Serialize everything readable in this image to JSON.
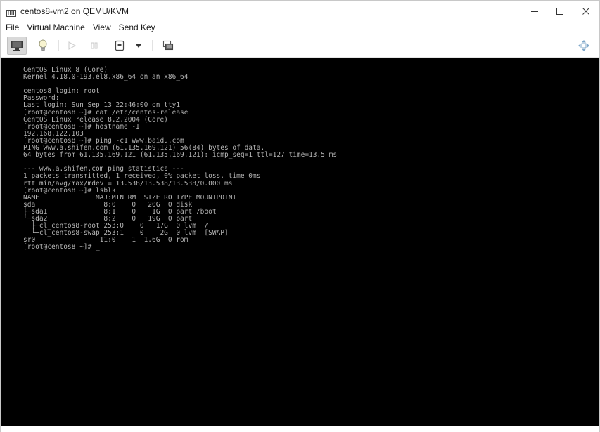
{
  "window": {
    "title": "centos8-vm2 on QEMU/KVM",
    "controls": {
      "minimize": "—",
      "maximize": "☐",
      "close": "✕"
    }
  },
  "menubar": {
    "items": [
      "File",
      "Virtual Machine",
      "View",
      "Send Key"
    ]
  },
  "toolbar": {
    "buttons": [
      {
        "name": "console-view-icon",
        "state": "pressed"
      },
      {
        "name": "lightbulb-details-icon",
        "state": "enabled"
      },
      {
        "name": "run-icon",
        "state": "disabled"
      },
      {
        "name": "pause-icon",
        "state": "disabled"
      },
      {
        "name": "power-icon",
        "state": "enabled"
      },
      {
        "name": "chevron-down-icon",
        "state": "enabled"
      },
      {
        "name": "snapshot-icon",
        "state": "enabled"
      },
      {
        "name": "fullscreen-resize-icon",
        "state": "enabled"
      }
    ]
  },
  "console": {
    "lines": [
      "CentOS Linux 8 (Core)",
      "Kernel 4.18.0-193.el8.x86_64 on an x86_64",
      "",
      "centos8 login: root",
      "Password:",
      "Last login: Sun Sep 13 22:46:00 on tty1",
      "[root@centos8 ~]# cat /etc/centos-release",
      "CentOS Linux release 8.2.2004 (Core)",
      "[root@centos8 ~]# hostname -I",
      "192.168.122.103",
      "[root@centos8 ~]# ping -c1 www.baidu.com",
      "PING www.a.shifen.com (61.135.169.121) 56(84) bytes of data.",
      "64 bytes from 61.135.169.121 (61.135.169.121): icmp_seq=1 ttl=127 time=13.5 ms",
      "",
      "--- www.a.shifen.com ping statistics ---",
      "1 packets transmitted, 1 received, 0% packet loss, time 0ms",
      "rtt min/avg/max/mdev = 13.538/13.538/13.538/0.000 ms",
      "[root@centos8 ~]# lsblk",
      "NAME              MAJ:MIN RM  SIZE RO TYPE MOUNTPOINT",
      "sda                 8:0    0   20G  0 disk",
      "├─sda1              8:1    0    1G  0 part /boot",
      "└─sda2              8:2    0   19G  0 part",
      "  ├─cl_centos8-root 253:0    0   17G  0 lvm  /",
      "  └─cl_centos8-swap 253:1    0    2G  0 lvm  [SWAP]",
      "sr0                11:0    1  1.6G  0 rom",
      "[root@centos8 ~]# _"
    ]
  },
  "colors": {
    "console_bg": "#000000",
    "console_fg": "#b4b4b4",
    "toolbar_pressed": "#d9d9d9"
  }
}
